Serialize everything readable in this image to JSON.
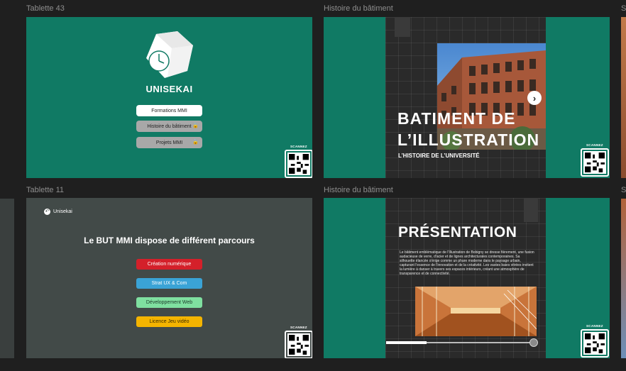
{
  "frames": {
    "f1": {
      "title": "Tablette 43",
      "brand": "UNISEKAI",
      "buttons": [
        "Formations MMI",
        "Histoire du bâtiment",
        "Projets MMI"
      ],
      "qr_label": "SCANNEZ"
    },
    "f2": {
      "title": "Histoire du bâtiment",
      "heading_line1": "BATIMENT DE",
      "heading_line2": "L’ILLUSTRATION",
      "subheading": "L’HISTOIRE DE L’UNIVERSITÉ",
      "qr_label": "SCANNEZ"
    },
    "f3": {
      "title": "Tablette 11",
      "back_label": "Unisekai",
      "heading": "Le BUT MMI dispose de différent parcours",
      "parcours": [
        {
          "label": "Création numérique",
          "bg": "#d4202a",
          "fg": "#ffffff"
        },
        {
          "label": "Strat UX & Com",
          "bg": "#3aa3d6",
          "fg": "#ffffff"
        },
        {
          "label": "Développement Web",
          "bg": "#7fe0a0",
          "fg": "#1c3b2a"
        },
        {
          "label": "Licence Jeu vidéo",
          "bg": "#f4b400",
          "fg": "#3a2a00"
        }
      ],
      "qr_label": "SCANNEZ"
    },
    "f4": {
      "title": "Histoire du bâtiment",
      "heading": "PRÉSENTATION",
      "paragraph": "Le bâtiment emblématique de l'Illustration de Bobigny se dresse fièrement, une fusion audacieuse de verre, d'acier et de lignes architecturales contemporaines. Sa silhouette élancée s'érige comme un phare moderne dans le paysage urbain, capturant l'essence de l'innovation et de la créativité. Les vastes baies vitrées invitent la lumière à danser à travers ses espaces intérieurs, créant une atmosphère de transparence et de connectivité.",
      "qr_label": "SCANNEZ",
      "progress": 0.27
    },
    "partial_label": "S"
  },
  "colors": {
    "green": "#107a64",
    "dark": "#2a2a2a",
    "slate": "#424a48"
  }
}
